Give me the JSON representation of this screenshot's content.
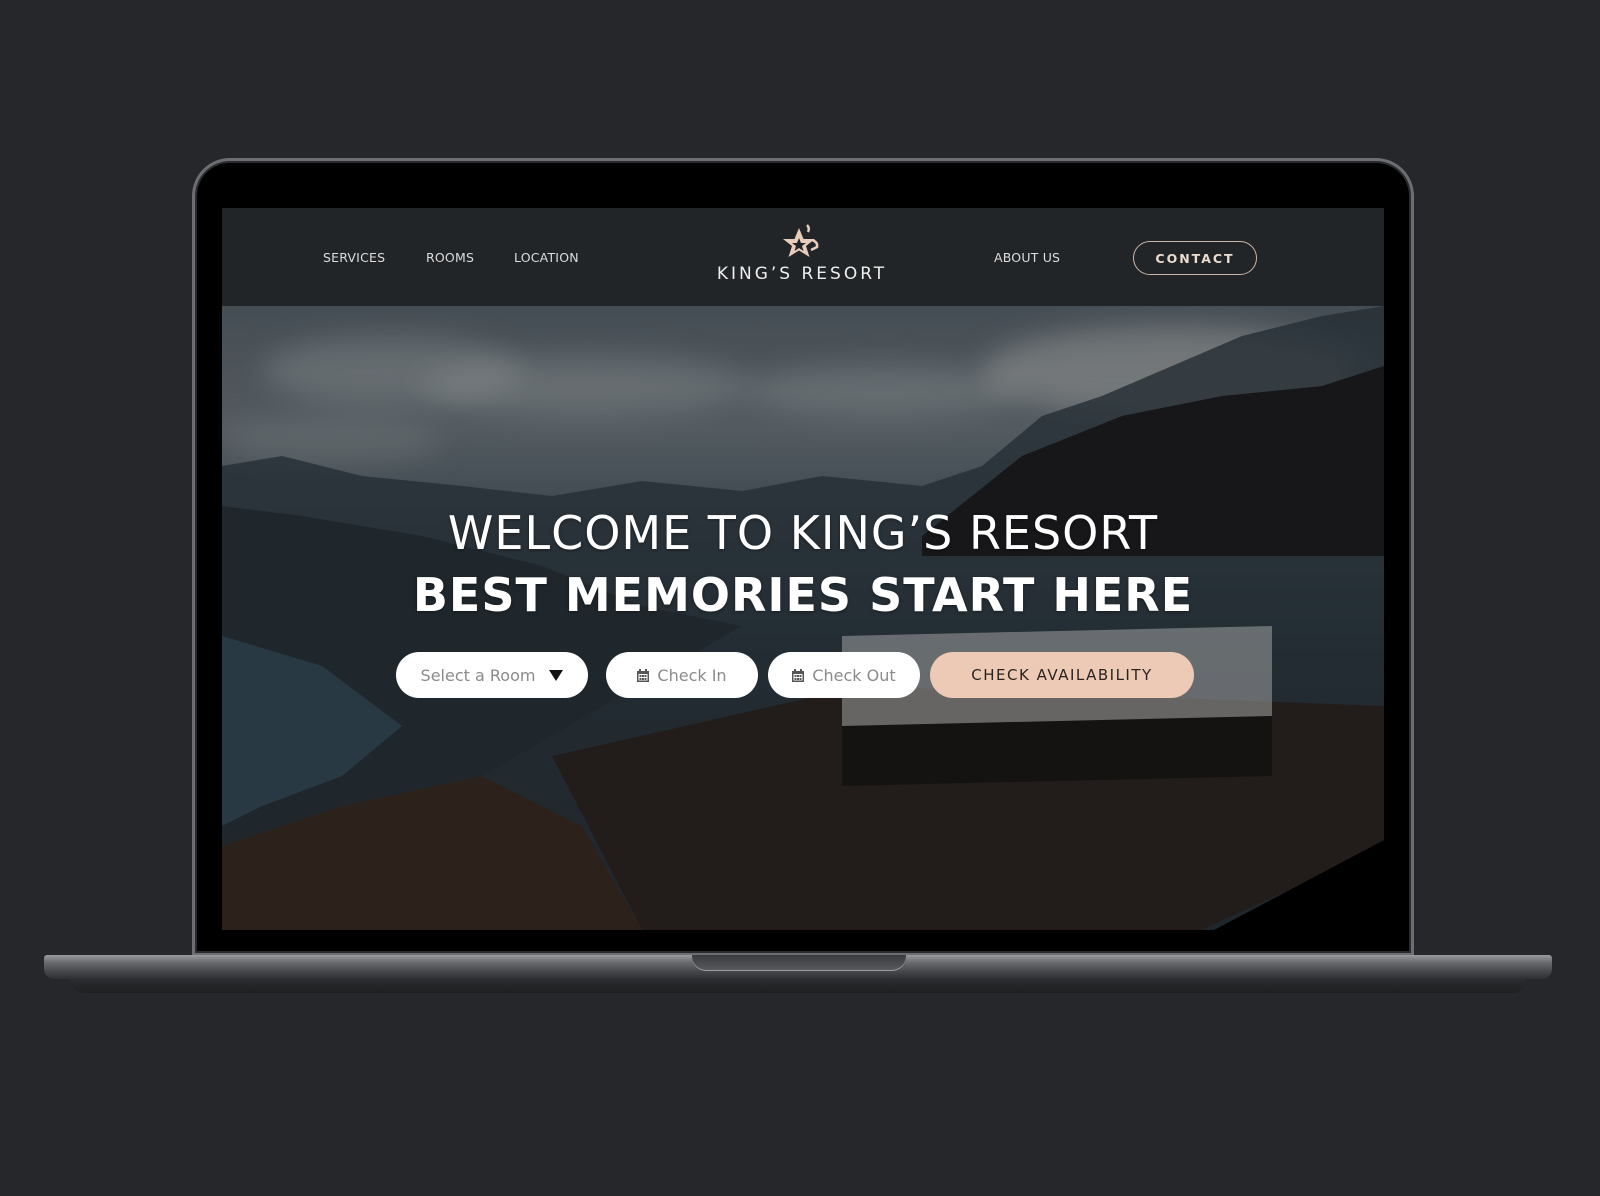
{
  "nav": {
    "left_links": [
      {
        "label": "SERVICES"
      },
      {
        "label": "ROOMS"
      },
      {
        "label": "LOCATION"
      }
    ],
    "right_links": [
      {
        "label": "ABOUT US"
      }
    ],
    "contact_button": "CONTACT",
    "logo": {
      "icon": "star-crown-icon",
      "text": "KING’S RESORT"
    }
  },
  "hero": {
    "headline_line1": "WELCOME TO KING’S RESORT",
    "headline_line2": "BEST MEMORIES START HERE"
  },
  "booking": {
    "room_select": {
      "value": "Select a Room",
      "icon": "caret-down-icon"
    },
    "check_in": {
      "placeholder": "Check In",
      "icon": "calendar-icon"
    },
    "check_out": {
      "placeholder": "Check Out",
      "icon": "calendar-icon"
    },
    "submit_label": "CHECK AVAILABILITY"
  },
  "colors": {
    "page_background": "#25272a",
    "navbar_background": "#222528",
    "accent_peach": "#eccab5",
    "logo_star": "#e8cdbb",
    "contact_border": "#c9b6a8"
  }
}
